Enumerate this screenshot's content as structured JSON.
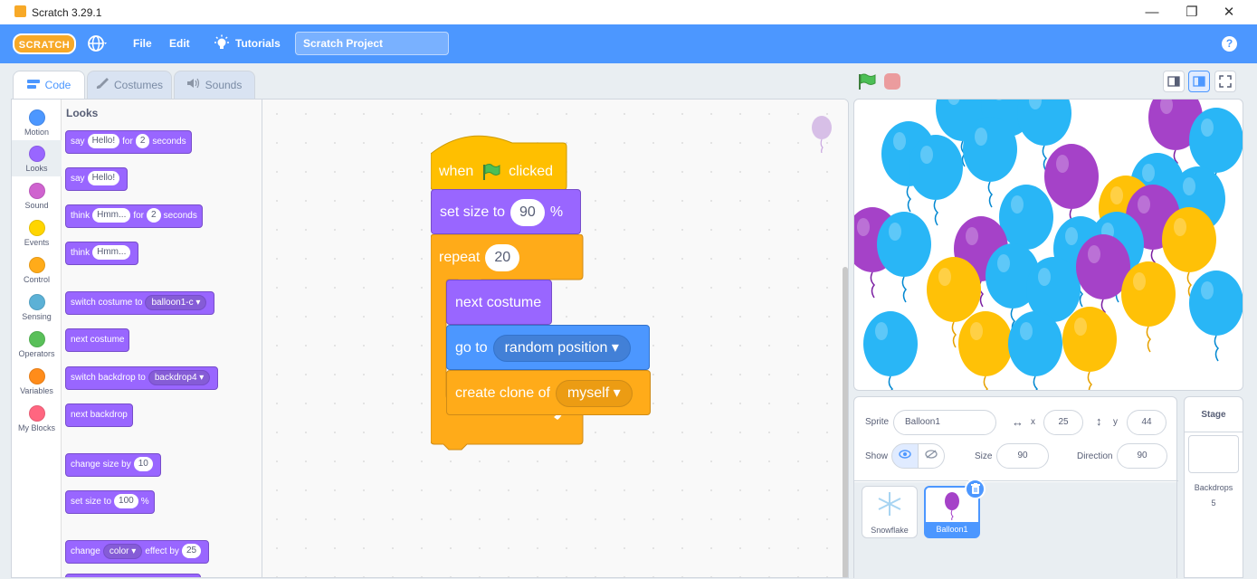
{
  "window": {
    "title": "Scratch 3.29.1",
    "minimize": "—",
    "restore": "❐",
    "close": "✕"
  },
  "menubar": {
    "logo": "SCRATCH",
    "file": "File",
    "edit": "Edit",
    "tutorials": "Tutorials",
    "project_name": "Scratch Project",
    "help": "?"
  },
  "tabs": [
    {
      "label": "Code",
      "icon": "code-icon"
    },
    {
      "label": "Costumes",
      "icon": "brush-icon"
    },
    {
      "label": "Sounds",
      "icon": "speaker-icon"
    }
  ],
  "categories": [
    {
      "label": "Motion",
      "color": "#4c97ff"
    },
    {
      "label": "Looks",
      "color": "#9966ff"
    },
    {
      "label": "Sound",
      "color": "#cf63cf"
    },
    {
      "label": "Events",
      "color": "#ffd500"
    },
    {
      "label": "Control",
      "color": "#ffab19"
    },
    {
      "label": "Sensing",
      "color": "#5cb1d6"
    },
    {
      "label": "Operators",
      "color": "#59c059"
    },
    {
      "label": "Variables",
      "color": "#ff8c1a"
    },
    {
      "label": "My Blocks",
      "color": "#ff6680"
    }
  ],
  "palette": {
    "title": "Looks",
    "say_for": {
      "say": "say",
      "msg": "Hello!",
      "for": "for",
      "secs": "2",
      "seconds": "seconds"
    },
    "say": {
      "say": "say",
      "msg": "Hello!"
    },
    "think_for": {
      "think": "think",
      "msg": "Hmm...",
      "for": "for",
      "secs": "2",
      "seconds": "seconds"
    },
    "think": {
      "think": "think",
      "msg": "Hmm..."
    },
    "switch_costume": {
      "label": "switch costume to",
      "value": "balloon1-c"
    },
    "next_costume": "next costume",
    "switch_backdrop": {
      "label": "switch backdrop to",
      "value": "backdrop4"
    },
    "next_backdrop": "next backdrop",
    "change_size": {
      "label": "change size by",
      "value": "10"
    },
    "set_size": {
      "label": "set size to",
      "value": "100",
      "unit": "%"
    },
    "change_effect": {
      "change": "change",
      "effect": "color",
      "by": "effect by",
      "value": "25"
    }
  },
  "script": {
    "when": "when",
    "clicked": "clicked",
    "set_size": "set size to",
    "size_value": "90",
    "percent": "%",
    "repeat": "repeat",
    "repeat_count": "20",
    "next_costume": "next costume",
    "go_to": "go to",
    "go_to_target": "random position",
    "create_clone": "create clone of",
    "clone_target": "myself"
  },
  "sprite_info": {
    "sprite_label": "Sprite",
    "sprite_name": "Balloon1",
    "x_label": "x",
    "x_value": "25",
    "y_label": "y",
    "y_value": "44",
    "show_label": "Show",
    "size_label": "Size",
    "size_value": "90",
    "direction_label": "Direction",
    "direction_value": "90"
  },
  "sprites": [
    {
      "name": "Snowflake",
      "selected": false
    },
    {
      "name": "Balloon1",
      "selected": true
    }
  ],
  "stage_panel": {
    "title": "Stage",
    "backdrops_label": "Backdrops",
    "backdrops_count": "5"
  },
  "colors": {
    "accent": "#4c97ff",
    "looks": "#9966ff",
    "control": "#ffab19",
    "events": "#ffbf00",
    "motion": "#4c97ff"
  }
}
